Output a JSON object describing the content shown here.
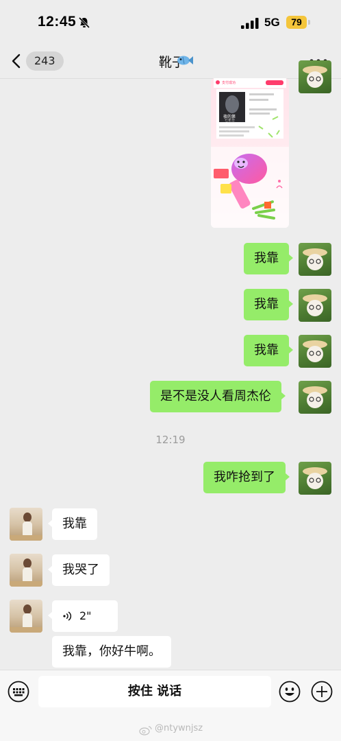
{
  "status_bar": {
    "time": "12:45",
    "network": "5G",
    "battery": "79"
  },
  "nav": {
    "unread_count": "243",
    "title": "靴子"
  },
  "messages": [
    {
      "side": "me",
      "text": "我靠"
    },
    {
      "side": "me",
      "text": "我靠"
    },
    {
      "side": "me",
      "text": "我靠"
    },
    {
      "side": "me",
      "text": "是不是没人看周杰伦"
    },
    {
      "side": "me",
      "text": "我咋抢到了"
    },
    {
      "side": "other",
      "text": "我靠"
    },
    {
      "side": "other",
      "text": "我哭了"
    },
    {
      "side": "other",
      "voice_duration": "2\""
    },
    {
      "side": "other",
      "text": "我靠，你好牛啊。"
    }
  ],
  "timestamp": "12:19",
  "sticker": {
    "header": "支付成功",
    "badge_line1": "夜的第",
    "badge_line2": "七年华"
  },
  "input_bar": {
    "hold_to_talk": "按住 说话"
  },
  "watermark": "@ntywnjsz",
  "colors": {
    "bubble_me": "#95ec69",
    "bubble_other": "#ffffff",
    "background": "#ededed"
  }
}
